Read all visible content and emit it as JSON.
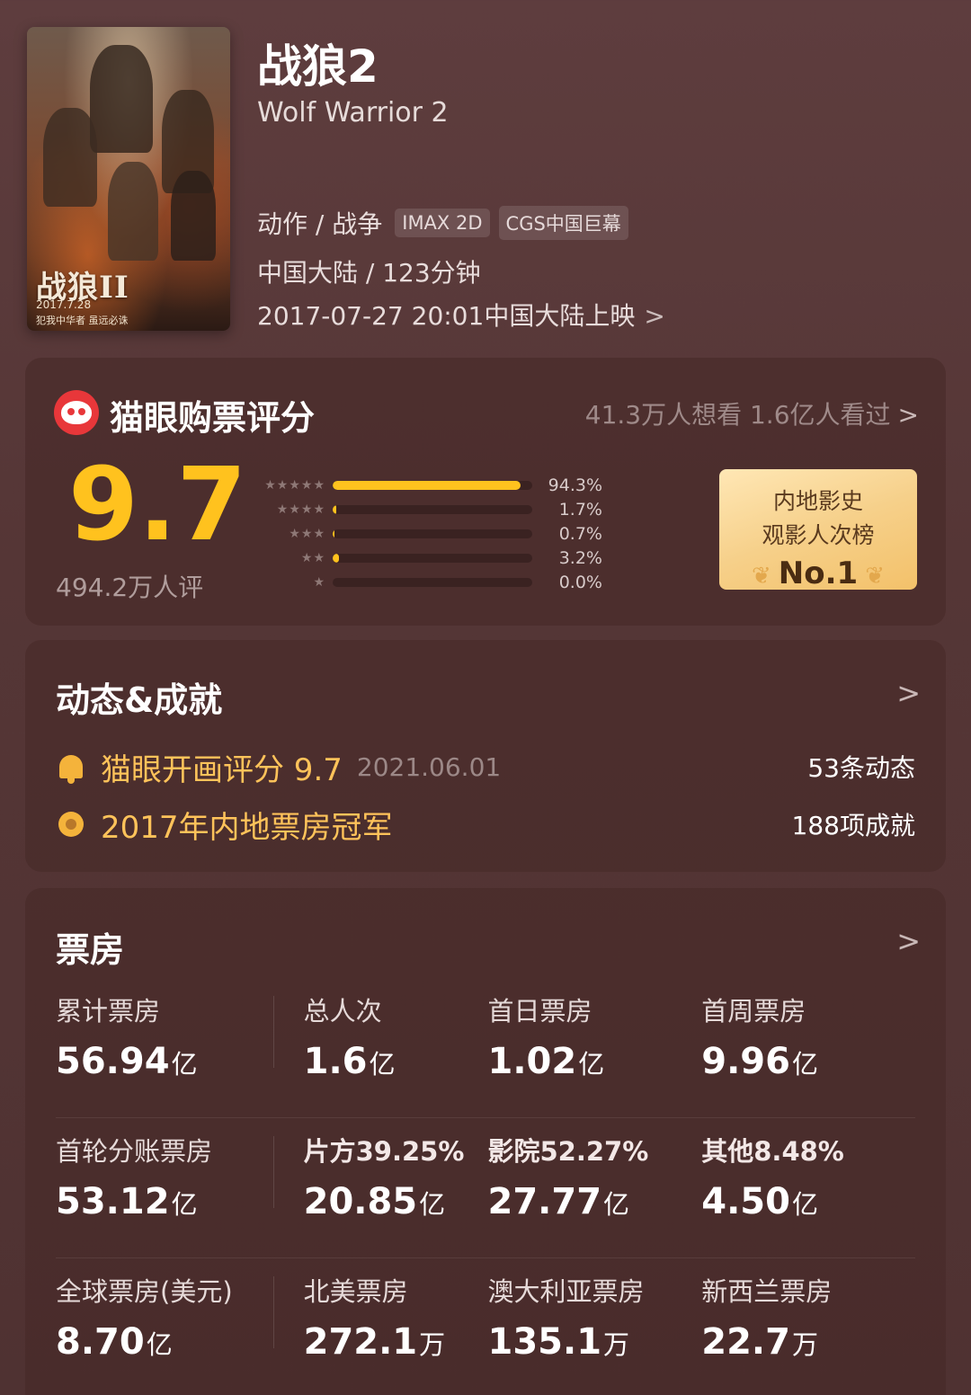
{
  "header": {
    "poster_title": "战狼II",
    "poster_date": "2017.7.28",
    "poster_slogan": "犯我中华者 虽远必诛",
    "title": "战狼2",
    "title_en": "Wolf Warrior 2",
    "genre": "动作 / 战争",
    "tags": [
      "IMAX 2D",
      "CGS中国巨幕"
    ],
    "region_duration": "中国大陆 / 123分钟",
    "release": "2017-07-27 20:01中国大陆上映",
    "release_chevron": ">"
  },
  "rating": {
    "title": "猫眼购票评分",
    "want_seen": "41.3万人想看 1.6亿人看过",
    "chevron": ">",
    "score": "9.7",
    "raters": "494.2万人评",
    "distribution": [
      {
        "stars": "★★★★★",
        "percent_label": "94.3%",
        "percent": 94.3
      },
      {
        "stars": "★★★★",
        "percent_label": "1.7%",
        "percent": 1.7
      },
      {
        "stars": "★★★",
        "percent_label": "0.7%",
        "percent": 0.7
      },
      {
        "stars": "★★",
        "percent_label": "3.2%",
        "percent": 3.2
      },
      {
        "stars": "★",
        "percent_label": "0.0%",
        "percent": 0.0
      }
    ],
    "rank_line1": "内地影史",
    "rank_line2": "观影人次榜",
    "rank_no": "No.1",
    "accent_color": "#ffc21e"
  },
  "dynamics": {
    "title": "动态&成就",
    "chevron": ">",
    "items": [
      {
        "icon": "bell-icon",
        "text": "猫眼开画评分 9.7",
        "date": "2021.06.01",
        "right": "53条动态"
      },
      {
        "icon": "medal-icon",
        "text": "2017年内地票房冠军",
        "date": "",
        "right": "188项成就"
      }
    ]
  },
  "box_office": {
    "title": "票房",
    "chevron": ">",
    "rows": [
      [
        {
          "label": "累计票房",
          "value": "56.94",
          "unit": "亿"
        },
        {
          "label": "总人次",
          "value": "1.6",
          "unit": "亿"
        },
        {
          "label": "首日票房",
          "value": "1.02",
          "unit": "亿"
        },
        {
          "label": "首周票房",
          "value": "9.96",
          "unit": "亿"
        }
      ],
      [
        {
          "label": "首轮分账票房",
          "value": "53.12",
          "unit": "亿"
        },
        {
          "label": "片方39.25%",
          "value": "20.85",
          "unit": "亿"
        },
        {
          "label": "影院52.27%",
          "value": "27.77",
          "unit": "亿"
        },
        {
          "label": "其他8.48%",
          "value": "4.50",
          "unit": "亿"
        }
      ],
      [
        {
          "label": "全球票房(美元)",
          "value": "8.70",
          "unit": "亿"
        },
        {
          "label": "北美票房",
          "value": "272.1",
          "unit": "万"
        },
        {
          "label": "澳大利亚票房",
          "value": "135.1",
          "unit": "万"
        },
        {
          "label": "新西兰票房",
          "value": "22.7",
          "unit": "万"
        }
      ]
    ]
  }
}
